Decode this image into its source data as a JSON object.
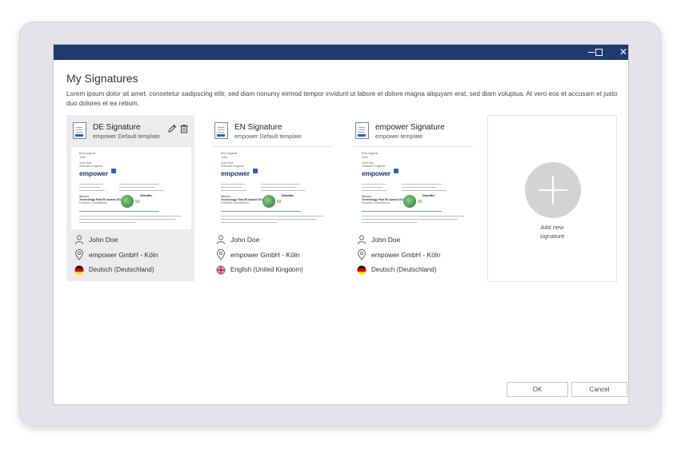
{
  "window": {
    "minimize_label": "",
    "maximize_label": "",
    "close_label": "✕"
  },
  "heading": "My Signatures",
  "description": "Lorem ipsum dolor sit amet, consetetur sadipscing elitr, sed diam nonumy eirmod tempor invidunt ut labore et dolore magna aliquyam erat, sed diam voluptua. At vero eos et accusam et justo duo dolores et ea rebum.",
  "signatures": [
    {
      "title": "DE Signature",
      "subtitle": "empower Default template",
      "user": "John Doe",
      "location": "empower GmbH - Köln",
      "language": "Deutsch (Deutschland)",
      "selected": true
    },
    {
      "title": "EN Signature",
      "subtitle": "empower Default template",
      "user": "John Doe",
      "location": "empower GmbH - Köln",
      "language": "English (United Kingdom)",
      "selected": false
    },
    {
      "title": "empower Signature",
      "subtitle": "empower template",
      "user": "John Doe",
      "location": "empower GmbH - Köln",
      "language": "Deutsch (Deutschland)",
      "selected": false
    }
  ],
  "preview": {
    "greeting": "Best regards",
    "name_line": "John",
    "person": "John Doe",
    "role": "Software Engineer",
    "logo": "empower",
    "award_title": "Winner",
    "award_line": "Technology Fast 50 Award 2019",
    "award_sub": "Powerful Connections",
    "award_brand": "Deloitte.",
    "award_number": "50"
  },
  "add_card": {
    "label_line1": "Add new",
    "label_line2": "signature"
  },
  "buttons": {
    "ok": "OK",
    "cancel": "Cancel"
  },
  "icons": {
    "edit": "pencil-icon",
    "delete": "trash-icon",
    "user": "user-icon",
    "location": "location-pin-icon",
    "flag_de": "flag-germany-icon",
    "flag_uk": "flag-uk-icon"
  }
}
